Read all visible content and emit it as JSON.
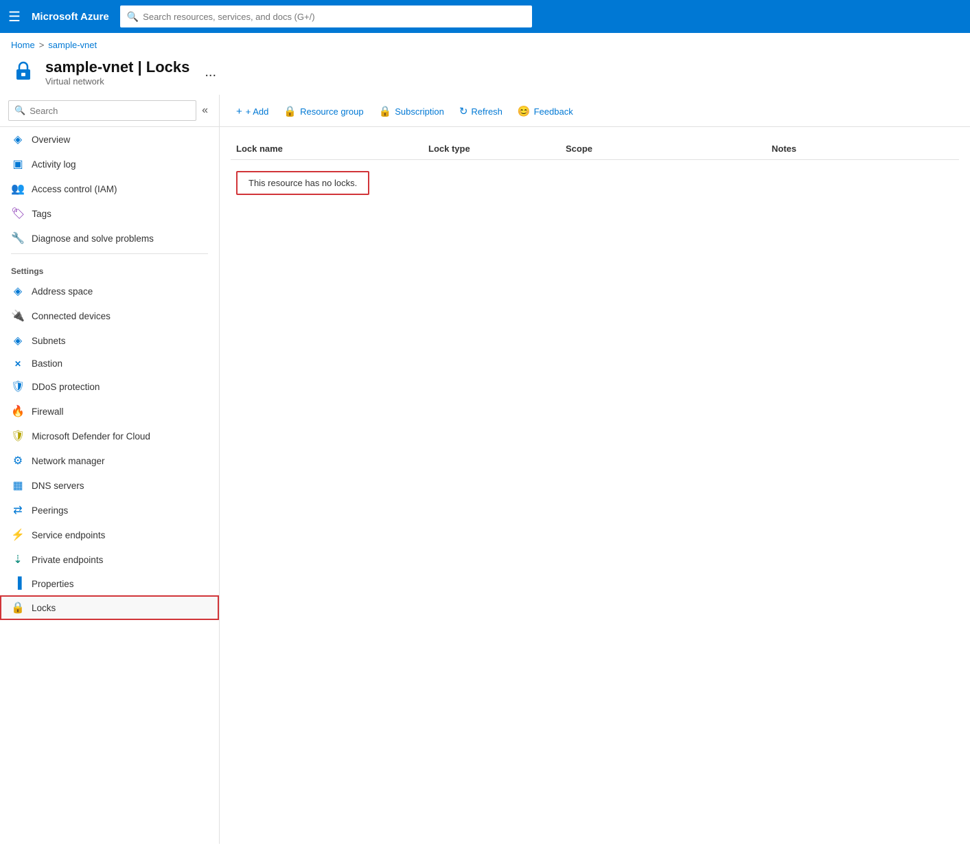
{
  "topbar": {
    "hamburger": "☰",
    "title": "Microsoft Azure",
    "search_placeholder": "Search resources, services, and docs (G+/)"
  },
  "breadcrumb": {
    "home": "Home",
    "separator": ">",
    "current": "sample-vnet"
  },
  "page_header": {
    "title": "sample-vnet | Locks",
    "subtitle": "Virtual network",
    "more_icon": "..."
  },
  "toolbar": {
    "add_label": "+ Add",
    "resource_group_label": "Resource group",
    "subscription_label": "Subscription",
    "refresh_label": "Refresh",
    "feedback_label": "Feedback"
  },
  "table": {
    "columns": {
      "lock_name": "Lock name",
      "lock_type": "Lock type",
      "scope": "Scope",
      "notes": "Notes"
    },
    "empty_message": "This resource has no locks."
  },
  "sidebar": {
    "search_placeholder": "Search",
    "collapse_icon": "«",
    "items": [
      {
        "id": "overview",
        "label": "Overview",
        "icon": "◈",
        "icon_color": "icon-blue"
      },
      {
        "id": "activity-log",
        "label": "Activity log",
        "icon": "▣",
        "icon_color": "icon-blue"
      },
      {
        "id": "access-control",
        "label": "Access control (IAM)",
        "icon": "👥",
        "icon_color": "icon-blue"
      },
      {
        "id": "tags",
        "label": "Tags",
        "icon": "🏷",
        "icon_color": "icon-purple"
      },
      {
        "id": "diagnose",
        "label": "Diagnose and solve problems",
        "icon": "🔧",
        "icon_color": "icon-grey"
      }
    ],
    "settings_label": "Settings",
    "settings_items": [
      {
        "id": "address-space",
        "label": "Address space",
        "icon": "◈",
        "icon_color": "icon-blue"
      },
      {
        "id": "connected-devices",
        "label": "Connected devices",
        "icon": "🔌",
        "icon_color": "icon-grey"
      },
      {
        "id": "subnets",
        "label": "Subnets",
        "icon": "◈",
        "icon_color": "icon-blue"
      },
      {
        "id": "bastion",
        "label": "Bastion",
        "icon": "✕",
        "icon_color": "icon-blue"
      },
      {
        "id": "ddos-protection",
        "label": "DDoS protection",
        "icon": "🛡",
        "icon_color": "icon-ddos"
      },
      {
        "id": "firewall",
        "label": "Firewall",
        "icon": "🔥",
        "icon_color": "icon-firewall"
      },
      {
        "id": "ms-defender",
        "label": "Microsoft Defender for Cloud",
        "icon": "🛡",
        "icon_color": "icon-gold"
      },
      {
        "id": "network-manager",
        "label": "Network manager",
        "icon": "⚙",
        "icon_color": "icon-blue"
      },
      {
        "id": "dns-servers",
        "label": "DNS servers",
        "icon": "▦",
        "icon_color": "icon-blue"
      },
      {
        "id": "peerings",
        "label": "Peerings",
        "icon": "⇄",
        "icon_color": "icon-blue"
      },
      {
        "id": "service-endpoints",
        "label": "Service endpoints",
        "icon": "⚡",
        "icon_color": "icon-blue"
      },
      {
        "id": "private-endpoints",
        "label": "Private endpoints",
        "icon": "⇣",
        "icon_color": "icon-teal"
      },
      {
        "id": "properties",
        "label": "Properties",
        "icon": "▐",
        "icon_color": "icon-blue"
      },
      {
        "id": "locks",
        "label": "Locks",
        "icon": "🔒",
        "icon_color": "icon-blue",
        "active": true
      }
    ]
  }
}
